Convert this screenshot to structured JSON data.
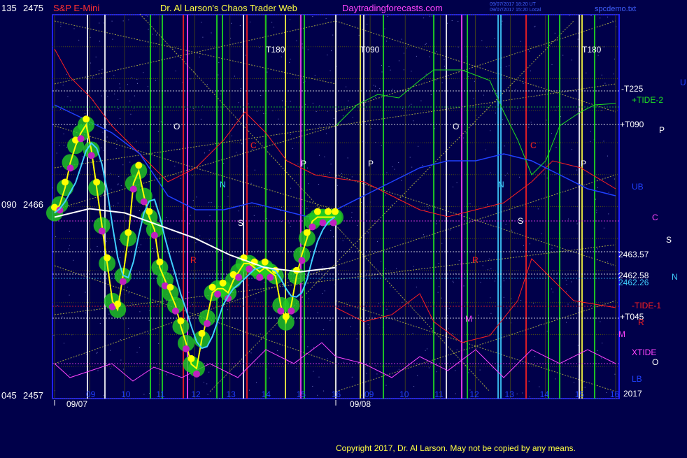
{
  "header": {
    "symbol": "S&P E-Mini",
    "author": "Dr. Al Larson's Chaos Trader Web",
    "site": "Daytradingforecasts.com",
    "timestamp_line1": "09/07/2017 18:20 UT",
    "timestamp_line2": "09/07/2017 15:20 Local",
    "file": "spcdemo.txt"
  },
  "colors": {
    "background": "#00004a",
    "plot_border": "#2020ff",
    "price_yellow": "#ffff00",
    "green_band": "#22cc22",
    "magenta": "#ff44ff",
    "cyan": "#40d0ff",
    "white": "#ffffff",
    "red": "#ff2020",
    "blue_line": "#2040ff",
    "green_line": "#20e020"
  },
  "chart_data": {
    "type": "line",
    "title": "S&P E-Mini",
    "y_axis_left": {
      "ticks": [
        {
          "degree": "135",
          "price": "2475",
          "value": 2475
        },
        {
          "degree": "090",
          "price": "2466",
          "value": 2466
        },
        {
          "degree": "045",
          "price": "2457",
          "value": 2457
        }
      ],
      "ylim": [
        2457,
        2475
      ]
    },
    "x_axis": {
      "hour_labels": [
        "09",
        "10",
        "11",
        "12",
        "13",
        "14",
        "15",
        "16",
        "09",
        "10",
        "11",
        "12",
        "13",
        "14",
        "15",
        "16"
      ],
      "date_labels": [
        "09/07",
        "09/08"
      ],
      "year_label": "2017",
      "xlim": [
        0,
        16
      ]
    },
    "price_label_markers": [
      {
        "label": "T180"
      },
      {
        "label": "T090"
      },
      {
        "label": "T180"
      }
    ],
    "right_side_labels": [
      {
        "text": "-T225",
        "color": "#ffffff"
      },
      {
        "text": "+TIDE-2",
        "color": "#20e020"
      },
      {
        "text": "+T090",
        "color": "#ffffff"
      },
      {
        "text": "2463.57",
        "color": "#ffffff"
      },
      {
        "text": "2462.58",
        "color": "#ffffff"
      },
      {
        "text": "2462.26",
        "color": "#40d0ff"
      },
      {
        "text": "-TIDE-1",
        "color": "#ff2020"
      },
      {
        "text": "+T045",
        "color": "#ffffff"
      },
      {
        "text": "XTIDE",
        "color": "#ff44ff"
      }
    ],
    "far_right_letters": [
      {
        "text": "U",
        "color": "#2040ff"
      },
      {
        "text": "P",
        "color": "#ffffff"
      },
      {
        "text": "UB",
        "color": "#2040ff"
      },
      {
        "text": "C",
        "color": "#ff44ff"
      },
      {
        "text": "S",
        "color": "#ffffff"
      },
      {
        "text": "N",
        "color": "#40d0ff"
      },
      {
        "text": "R",
        "color": "#ff2020"
      },
      {
        "text": "M",
        "color": "#ff44ff"
      },
      {
        "text": "O",
        "color": "#ffffff"
      },
      {
        "text": "LB",
        "color": "#2040ff"
      }
    ],
    "series": [
      {
        "name": "price",
        "x": [
          0,
          0.15,
          0.3,
          0.45,
          0.6,
          0.75,
          0.9,
          1.05,
          1.2,
          1.35,
          1.5,
          1.65,
          1.8,
          1.95,
          2.1,
          2.25,
          2.4,
          2.55,
          2.7,
          2.85,
          3.0,
          3.15,
          3.3,
          3.45,
          3.6,
          3.75,
          3.9,
          4.05,
          4.2,
          4.35,
          4.5,
          4.65,
          4.8,
          4.95,
          5.1,
          5.25,
          5.4,
          5.55,
          5.7,
          5.85,
          6.0,
          6.15,
          6.3,
          6.45,
          6.6,
          6.75,
          6.9,
          7.05,
          7.2,
          7.35,
          7.5,
          7.65,
          7.8,
          7.95,
          8.0
        ],
        "values": [
          2465.6,
          2466.0,
          2466.8,
          2468.0,
          2468.8,
          2469.4,
          2469.8,
          2468.6,
          2466.8,
          2465.0,
          2463.2,
          2461.4,
          2461.0,
          2462.6,
          2464.4,
          2467.0,
          2467.6,
          2466.4,
          2465.4,
          2464.8,
          2463.0,
          2462.4,
          2461.8,
          2461.2,
          2460.2,
          2459.4,
          2458.4,
          2458.2,
          2459.6,
          2460.6,
          2461.8,
          2462.0,
          2462.0,
          2461.8,
          2462.4,
          2462.8,
          2463.2,
          2463.2,
          2463.0,
          2462.8,
          2463.0,
          2462.8,
          2462.6,
          2461.2,
          2460.4,
          2461.2,
          2462.6,
          2463.6,
          2464.4,
          2465.2,
          2465.4,
          2465.4,
          2465.4,
          2465.4,
          2465.4
        ]
      },
      {
        "name": "",
        "x": [
          0,
          1,
          2,
          3,
          4,
          5,
          6,
          7,
          8
        ],
        "values": [
          2465.4,
          2465.8,
          2465.6,
          2465.0,
          2464.4,
          2463.6,
          2463.0,
          2462.8,
          2463.0
        ]
      }
    ],
    "grid": true,
    "legend": "none"
  },
  "footer": {
    "copyright": "Copyright 2017, Dr. Al Larson. May not be copied by any means."
  }
}
